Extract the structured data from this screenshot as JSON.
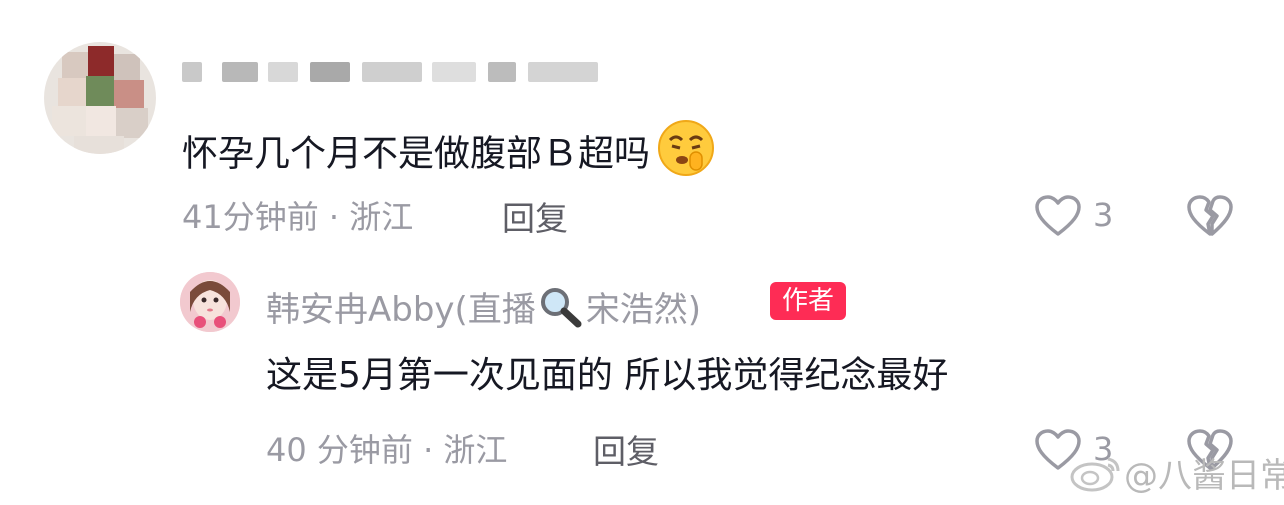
{
  "comments": [
    {
      "text": "怀孕几个月不是做腹部Ｂ超吗",
      "emoji": "shushing-face-emoji",
      "time_location": "41分钟前 · 浙江",
      "reply_label": "回复",
      "likes": "3"
    },
    {
      "author": "韩安冉Abby(直播",
      "author_icon": "magnifier-emoji",
      "author_suffix": "宋浩然)",
      "badge": "作者",
      "text": "这是5月第一次见面的 所以我觉得纪念最好",
      "time_location": "40 分钟前 · 浙江",
      "reply_label": "回复",
      "likes": "3"
    }
  ],
  "watermark": {
    "text": "@八酱日常",
    "logo": "weibo-logo"
  },
  "colors": {
    "badge": "#fe2c55",
    "text": "#161823",
    "meta": "#9a9aa3"
  }
}
